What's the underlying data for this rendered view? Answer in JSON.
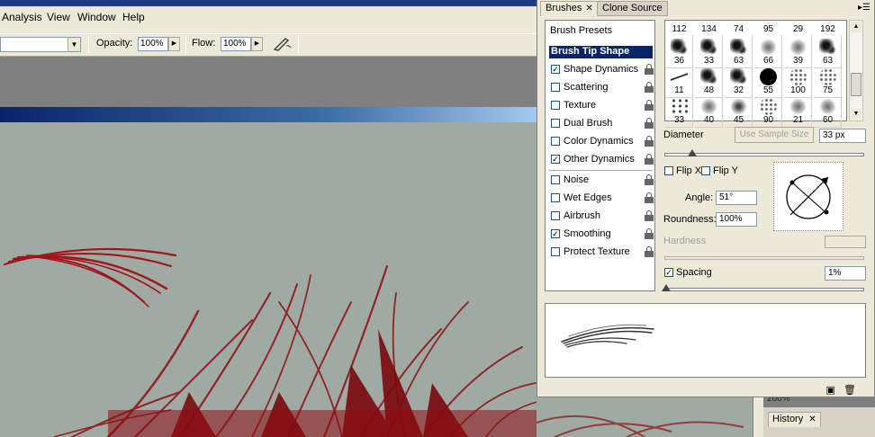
{
  "menu": [
    "Analysis",
    "View",
    "Window",
    "Help"
  ],
  "options_bar": {
    "opacity_label": "Opacity:",
    "opacity_value": "100%",
    "flow_label": "Flow:",
    "flow_value": "100%"
  },
  "panel": {
    "tabs": [
      {
        "label": "Brushes"
      },
      {
        "label": "Clone Source"
      }
    ],
    "brush_presets": "Brush Presets",
    "brush_tip_shape": "Brush Tip Shape",
    "options": [
      {
        "label": "Shape Dynamics",
        "checked": true
      },
      {
        "label": "Scattering",
        "checked": false
      },
      {
        "label": "Texture",
        "checked": false
      },
      {
        "label": "Dual Brush",
        "checked": false
      },
      {
        "label": "Color Dynamics",
        "checked": false
      },
      {
        "label": "Other Dynamics",
        "checked": true
      },
      {
        "label": "Noise",
        "checked": false
      },
      {
        "label": "Wet Edges",
        "checked": false
      },
      {
        "label": "Airbrush",
        "checked": false
      },
      {
        "label": "Smoothing",
        "checked": true
      },
      {
        "label": "Protect Texture",
        "checked": false
      }
    ],
    "grid_top_row": [
      "112",
      "134",
      "74",
      "95",
      "29",
      "192"
    ],
    "grid_rows": [
      [
        "36",
        "33",
        "63",
        "66",
        "39",
        "63"
      ],
      [
        "11",
        "48",
        "32",
        "55",
        "100",
        "75"
      ],
      [
        "33",
        "40",
        "45",
        "90",
        "21",
        "60"
      ]
    ],
    "diameter_label": "Diameter",
    "use_sample_size": "Use Sample Size",
    "diameter_value": "33 px",
    "diameter_level": 0.14,
    "flip_x": "Flip X",
    "flip_y": "Flip Y",
    "angle_label": "Angle:",
    "angle_value": "51°",
    "roundness_label": "Roundness:",
    "roundness_value": "100%",
    "hardness_label": "Hardness",
    "spacing_label": "Spacing",
    "spacing_checked": true,
    "spacing_value": "1%",
    "spacing_level": 0.0
  },
  "history": {
    "tab_label": "History",
    "zoom_text": "200%"
  },
  "colors": {
    "selection": "#0a246a",
    "canvas": "#9eaaa2",
    "brush_red": "#9a0d10"
  }
}
